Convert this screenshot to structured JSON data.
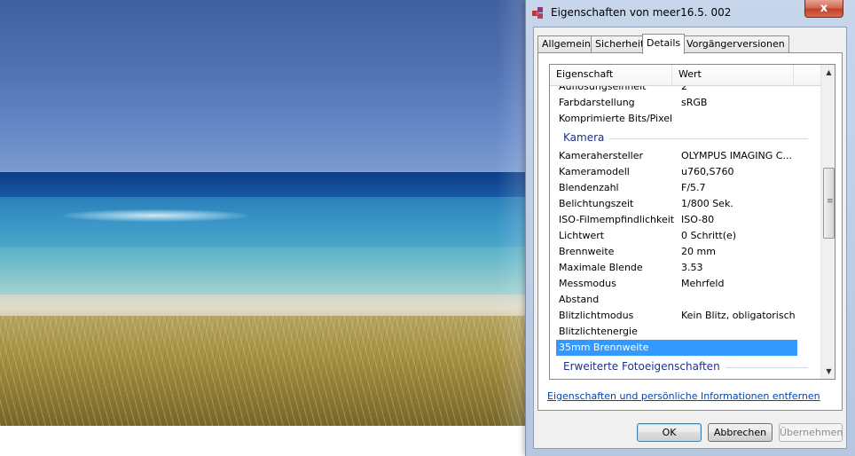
{
  "window": {
    "title": "Eigenschaften von meer16.5. 002",
    "close_label": "x"
  },
  "tabs": [
    {
      "label": "Allgemein",
      "active": false
    },
    {
      "label": "Sicherheit",
      "active": false
    },
    {
      "label": "Details",
      "active": true
    },
    {
      "label": "Vorgängerversionen",
      "active": false
    }
  ],
  "list": {
    "header": {
      "property": "Eigenschaft",
      "value": "Wert"
    },
    "rows": [
      {
        "property": "Auflösungseinheit",
        "value": "2",
        "partial": true
      },
      {
        "property": "Farbdarstellung",
        "value": "sRGB"
      },
      {
        "property": "Komprimierte Bits/Pixel",
        "value": ""
      },
      {
        "group": "Kamera"
      },
      {
        "property": "Kamerahersteller",
        "value": "OLYMPUS IMAGING C..."
      },
      {
        "property": "Kameramodell",
        "value": "u760,S760"
      },
      {
        "property": "Blendenzahl",
        "value": "F/5.7"
      },
      {
        "property": "Belichtungszeit",
        "value": "1/800 Sek."
      },
      {
        "property": "ISO-Filmempfindlichkeit",
        "value": "ISO-80"
      },
      {
        "property": "Lichtwert",
        "value": "0 Schritt(e)"
      },
      {
        "property": "Brennweite",
        "value": "20 mm"
      },
      {
        "property": "Maximale Blende",
        "value": "3.53"
      },
      {
        "property": "Messmodus",
        "value": "Mehrfeld"
      },
      {
        "property": "Abstand",
        "value": ""
      },
      {
        "property": "Blitzlichtmodus",
        "value": "Kein Blitz, obligatorisch"
      },
      {
        "property": "Blitzlichtenergie",
        "value": ""
      },
      {
        "property": "35mm Brennweite",
        "value": "",
        "selected": true
      },
      {
        "group": "Erweiterte Fotoeigenschaften"
      }
    ]
  },
  "link": {
    "remove_label": "Eigenschaften und persönliche Informationen entfernen"
  },
  "buttons": {
    "ok": "OK",
    "cancel": "Abbrechen",
    "apply": "Übernehmen"
  },
  "icons": {
    "title": "properties-puzzle-icon",
    "scroll_up": "chevron-up-icon",
    "scroll_down": "chevron-down-icon"
  },
  "colors": {
    "selection": "#3399ff",
    "group_label": "#1e3287",
    "link": "#0645ad"
  }
}
